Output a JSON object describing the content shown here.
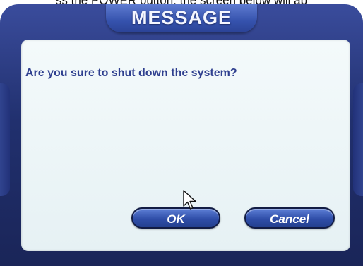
{
  "caption": "ss the POWER button, the screen below will ap",
  "dialog": {
    "title": "MESSAGE",
    "message": "Are you sure to shut down the system?",
    "buttons": {
      "ok_label": "OK",
      "cancel_label": "Cancel"
    }
  },
  "icons": {
    "cursor": "mouse-pointer-icon"
  },
  "colors": {
    "frame": "#21306e",
    "title_tab": "#3552ad",
    "content_background": "#eef6f8",
    "message_text": "#2f3f8f",
    "button_fill": "#2f4ea8"
  }
}
